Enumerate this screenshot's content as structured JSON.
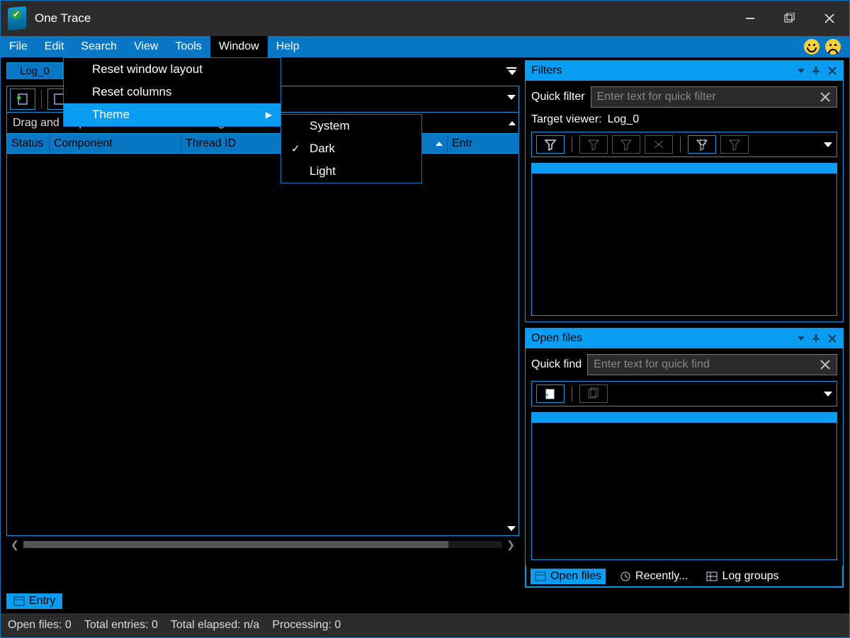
{
  "app": {
    "title": "One Trace"
  },
  "menubar": {
    "file": "File",
    "edit": "Edit",
    "search": "Search",
    "view": "View",
    "tools": "Tools",
    "window": "Window",
    "help": "Help"
  },
  "window_menu": {
    "reset_layout": "Reset window layout",
    "reset_columns": "Reset columns",
    "theme": "Theme"
  },
  "theme_menu": {
    "system": "System",
    "dark": "Dark",
    "light": "Light",
    "selected": "Dark"
  },
  "doc": {
    "tab_label": "Log_0",
    "groupby_hint": "Drag and drop a column into this area to grou"
  },
  "columns": {
    "status": "Status",
    "component": "Component",
    "thread_id": "Thread ID",
    "blank": "",
    "entry": "Entr"
  },
  "filters_panel": {
    "title": "Filters",
    "quick_label": "Quick filter",
    "quick_placeholder": "Enter text for quick filter",
    "target_label": "Target viewer:",
    "target_value": "Log_0"
  },
  "openfiles_panel": {
    "title": "Open files",
    "quick_label": "Quick find",
    "quick_placeholder": "Enter text for quick find"
  },
  "bottom_tabs": {
    "open_files": "Open files",
    "recently": "Recently...",
    "log_groups": "Log groups"
  },
  "entry_tab": {
    "label": "Entry"
  },
  "status": {
    "open_files": "Open files: 0",
    "total_entries": "Total entries: 0",
    "total_elapsed": "Total elapsed: n/a",
    "processing": "Processing: 0"
  }
}
